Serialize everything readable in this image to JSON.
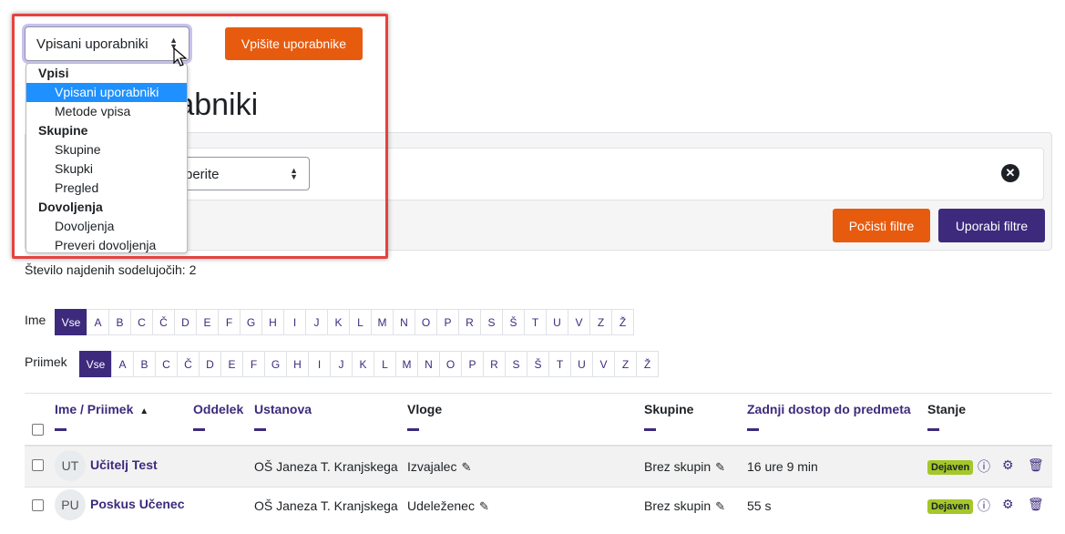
{
  "top": {
    "select_value": "Vpisani uporabniki",
    "enrol_button": "Vpišite uporabnike"
  },
  "page_heading_partial": "rabniki",
  "dropdown": {
    "items": [
      {
        "type": "group",
        "label": "Vpisi"
      },
      {
        "type": "option",
        "label": "Vpisani uporabniki",
        "selected": true
      },
      {
        "type": "option",
        "label": "Metode vpisa"
      },
      {
        "type": "group",
        "label": "Skupine"
      },
      {
        "type": "option",
        "label": "Skupine"
      },
      {
        "type": "option",
        "label": "Skupki"
      },
      {
        "type": "option",
        "label": "Pregled"
      },
      {
        "type": "group",
        "label": "Dovoljenja"
      },
      {
        "type": "option",
        "label": "Dovoljenja"
      },
      {
        "type": "option",
        "label": "Preveri dovoljenja"
      }
    ]
  },
  "filter": {
    "select_value_partial": "berite",
    "reset_button": "Počisti filtre",
    "apply_button": "Uporabi filtre"
  },
  "count_text": "Število najdenih sodelujočih: 2",
  "initials": {
    "first_label": "Ime",
    "last_label": "Priimek",
    "all_label": "Vse",
    "letters": [
      "A",
      "B",
      "C",
      "Č",
      "D",
      "E",
      "F",
      "G",
      "H",
      "I",
      "J",
      "K",
      "L",
      "M",
      "N",
      "O",
      "P",
      "R",
      "S",
      "Š",
      "T",
      "U",
      "V",
      "Z",
      "Ž"
    ]
  },
  "table": {
    "headers": {
      "name": "Ime / Priimek",
      "sort_indicator": "▲",
      "department": "Oddelek",
      "institution": "Ustanova",
      "roles": "Vloge",
      "groups": "Skupine",
      "last_access": "Zadnji dostop do predmeta",
      "status": "Stanje"
    },
    "rows": [
      {
        "initials": "UT",
        "name": "Učitelj Test",
        "institution": "OŠ Janeza T. Kranjskega",
        "role": "Izvajalec",
        "groups": "Brez skupin",
        "last_access": "16 ure 9 min",
        "status": "Dejaven"
      },
      {
        "initials": "PU",
        "name": "Poskus Učenec",
        "institution": "OŠ Janeza T. Kranjskega",
        "role": "Udeleženec",
        "groups": "Brez skupin",
        "last_access": "55 s",
        "status": "Dejaven"
      }
    ]
  },
  "colors": {
    "primary": "#3d2a7d",
    "orange": "#e75b0f",
    "badge_green": "#a4c72a",
    "highlight_red": "#e5423f",
    "selected_blue": "#1e90ff"
  }
}
